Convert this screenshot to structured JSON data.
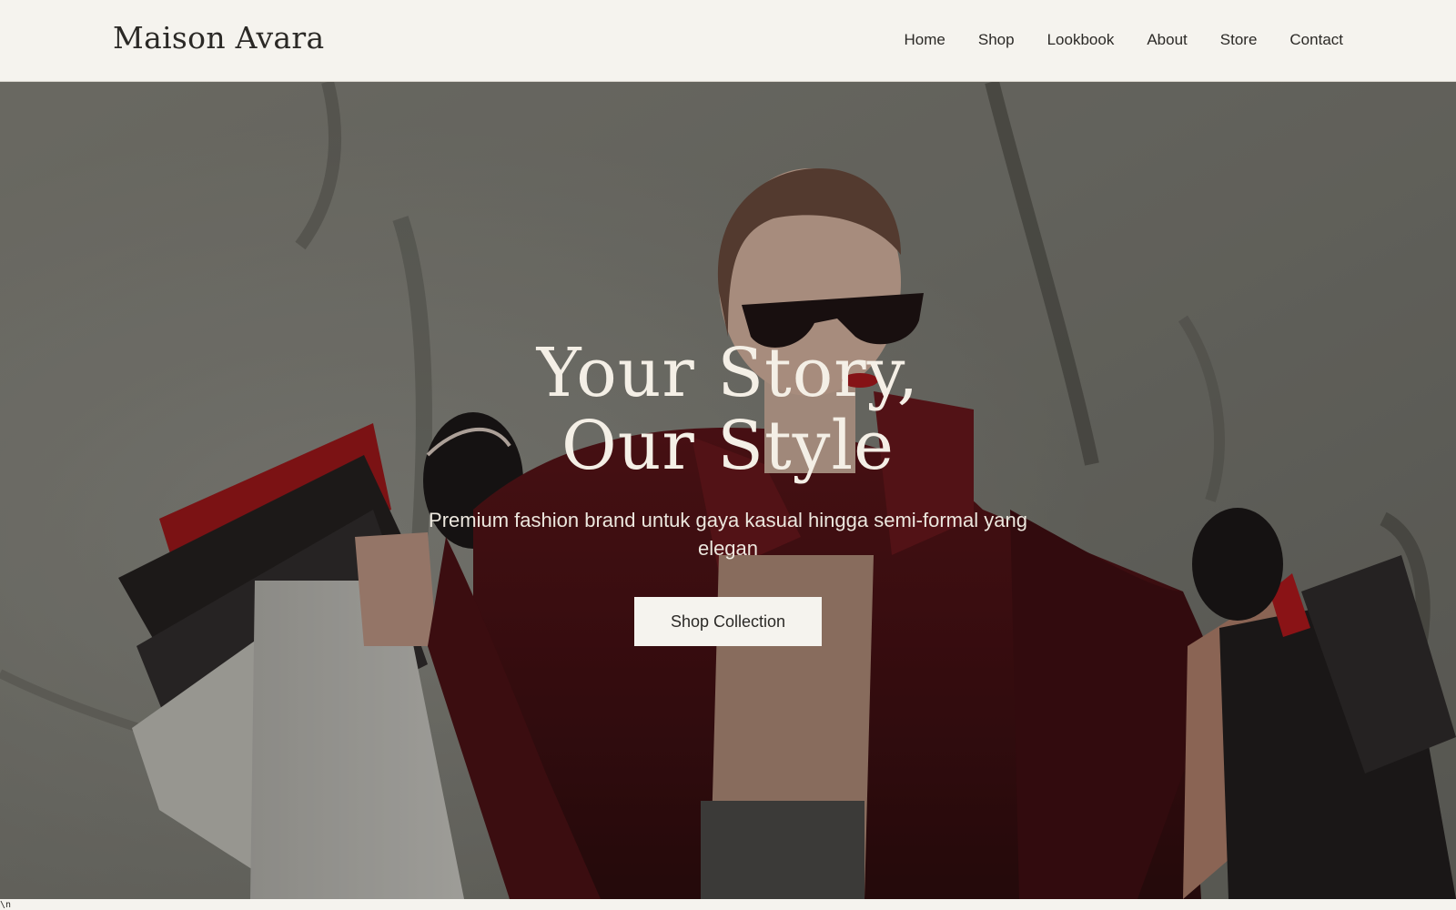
{
  "brand": {
    "name": "Maison Avara"
  },
  "nav": {
    "links": [
      "Home",
      "Shop",
      "Lookbook",
      "About",
      "Store",
      "Contact"
    ]
  },
  "hero": {
    "title_line1": "Your Story,",
    "title_line2": "Our Style",
    "subtitle": "Premium fashion brand untuk gaya kasual hingga semi-formal yang elegan",
    "cta_label": "Shop Collection",
    "image_description_icon": "hero-photo"
  },
  "footer": {
    "stray_text": "\\n"
  },
  "colors": {
    "background": "#f5f3ee",
    "text": "#2b2926",
    "hero_text": "#f4efe6",
    "accent_red": "#8e1a1f"
  }
}
